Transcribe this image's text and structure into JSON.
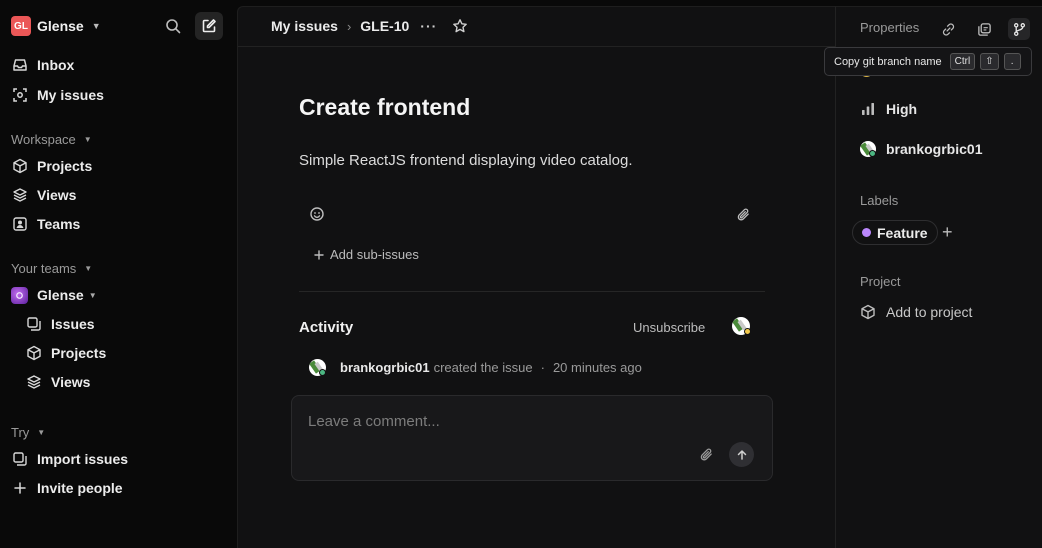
{
  "sidebar": {
    "workspace": {
      "initials": "GL",
      "name": "Glense"
    },
    "nav": [
      {
        "label": "Inbox",
        "icon": "inbox-icon"
      },
      {
        "label": "My issues",
        "icon": "my-issues-icon"
      }
    ],
    "workspace_section": {
      "label": "Workspace",
      "items": [
        {
          "label": "Projects",
          "icon": "cube-icon"
        },
        {
          "label": "Views",
          "icon": "layers-icon"
        },
        {
          "label": "Teams",
          "icon": "teams-icon"
        }
      ]
    },
    "teams_section": {
      "label": "Your teams",
      "team_name": "Glense",
      "items": [
        {
          "label": "Issues",
          "icon": "issues-icon"
        },
        {
          "label": "Projects",
          "icon": "cube-icon"
        },
        {
          "label": "Views",
          "icon": "layers-icon"
        }
      ]
    },
    "try_section": {
      "label": "Try",
      "items": [
        {
          "label": "Import issues",
          "icon": "import-icon"
        },
        {
          "label": "Invite people",
          "icon": "plus-icon"
        }
      ]
    }
  },
  "breadcrumb": {
    "parent": "My issues",
    "separator": "›",
    "current": "GLE-10",
    "more": "···"
  },
  "issue": {
    "title": "Create frontend",
    "description": "Simple ReactJS frontend displaying video catalog.",
    "add_sub_issues": "Add sub-issues"
  },
  "activity": {
    "title": "Activity",
    "unsubscribe": "Unsubscribe",
    "entries": [
      {
        "user": "brankogrbic01",
        "action": "created the issue",
        "separator": "·",
        "time": "20 minutes ago"
      }
    ],
    "comment_placeholder": "Leave a comment..."
  },
  "properties": {
    "title": "Properties",
    "priority": "High",
    "assignee": "brankogrbic01",
    "labels_heading": "Labels",
    "labels": [
      {
        "name": "Feature",
        "color": "#bb87fc"
      }
    ],
    "add_label": "+",
    "project_heading": "Project",
    "add_to_project": "Add to project"
  },
  "tooltip": {
    "text": "Copy git branch name",
    "keys": [
      "Ctrl",
      "⇧",
      "."
    ]
  },
  "colors": {
    "background": "#090909",
    "panel": "#111112",
    "accent_label": "#bb87fc",
    "online": "#4cb782",
    "workspace_logo": "#eb5757"
  }
}
